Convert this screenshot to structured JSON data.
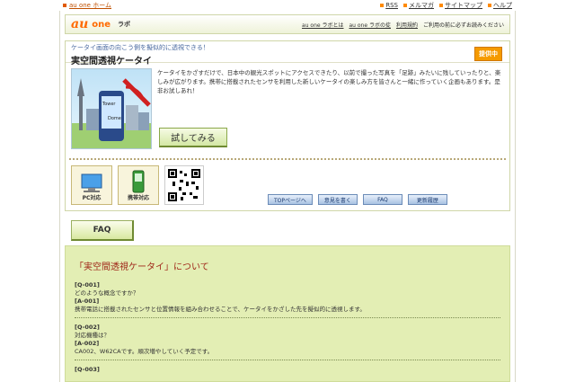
{
  "top": {
    "home_link": "au one ホーム",
    "links": [
      "RSS",
      "メルマガ",
      "サイトマップ",
      "ヘルプ"
    ]
  },
  "header": {
    "logo_au": "au",
    "logo_one": "one",
    "logo_labo": "ラボ",
    "links": [
      "au one ラボとは",
      "au one ラボの掟",
      "利用規約"
    ],
    "note": "ご利用の前に必ずお読みください"
  },
  "card": {
    "subtitle": "ケータイ画面の向こう側を擬似的に透視できる！",
    "title": "実空間透視ケータイ",
    "badge": "提供中",
    "description": "ケータイをかざすだけで、日本中の観光スポットにアクセスできたり、以前で撮った写真を「足跡」みたいに残していったりと、楽しみが広がります。携帯に搭載されたセンサを利用した新しいケータイの楽しみ方を皆さんと一緒に作っていく企画もあります。是非お試しあれ！",
    "try_button": "試してみる",
    "pc_label": "PC対応",
    "mobile_label": "携帯対応",
    "nav": [
      "TOPページへ",
      "意見を書く",
      "FAQ",
      "更新履歴"
    ]
  },
  "illustration": {
    "tower_label": "Tower",
    "dome_label": "Dome"
  },
  "faq": {
    "tab": "FAQ",
    "heading": "「実空間透視ケータイ」について",
    "items": [
      {
        "q_tag": "[Q-001]",
        "q": "どのような概念ですか？",
        "a_tag": "[A-001]",
        "a": "携帯電話に搭載されたセンサと位置情報を組み合わせることで、ケータイをかざした先を擬似的に透視します。"
      },
      {
        "q_tag": "[Q-002]",
        "q": "対応機種は？",
        "a_tag": "[A-002]",
        "a": "CA002、W62CAです。順次増やしていく予定です。"
      },
      {
        "q_tag": "[Q-003]",
        "q": "",
        "a_tag": "",
        "a": ""
      }
    ]
  },
  "colors": {
    "accent_orange": "#ff6a00",
    "faq_bg": "#e3eeb4",
    "faq_heading": "#a0281a"
  }
}
